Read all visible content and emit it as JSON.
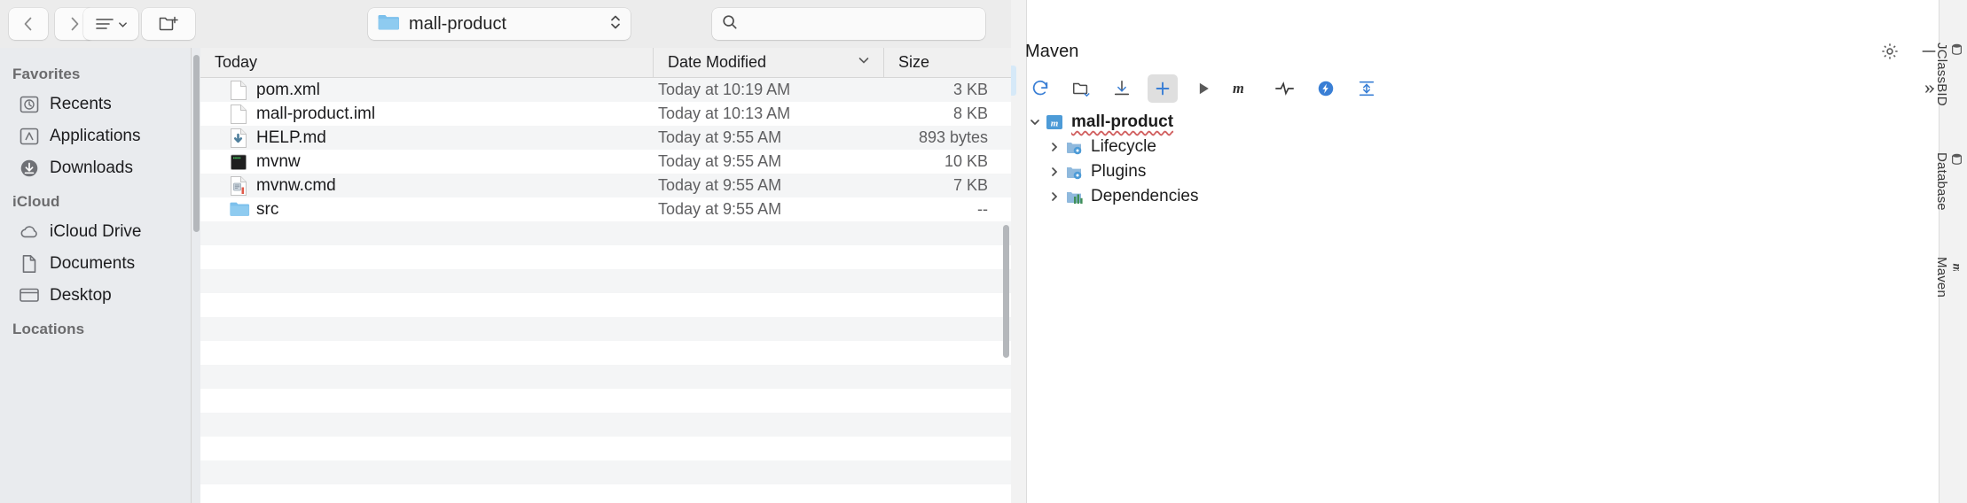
{
  "finder": {
    "toolbar": {
      "back_label": "Back",
      "forward_label": "Forward",
      "view_label": "View options",
      "new_folder_label": "New Folder",
      "path_label": "mall-product",
      "path_icon": "folder-icon",
      "search_placeholder": "",
      "search_value": "",
      "search_icon": "search-icon"
    },
    "sidebar": {
      "sections": [
        {
          "title": "Favorites",
          "items": [
            {
              "label": "Recents",
              "icon": "clock-icon"
            },
            {
              "label": "Applications",
              "icon": "applications-icon"
            },
            {
              "label": "Downloads",
              "icon": "downloads-icon"
            }
          ]
        },
        {
          "title": "iCloud",
          "items": [
            {
              "label": "iCloud Drive",
              "icon": "cloud-icon"
            },
            {
              "label": "Documents",
              "icon": "documents-icon"
            },
            {
              "label": "Desktop",
              "icon": "desktop-icon"
            }
          ]
        },
        {
          "title": "Locations",
          "items": []
        }
      ]
    },
    "columns": {
      "name": "Today",
      "date_modified": "Date Modified",
      "size": "Size",
      "sort_icon": "chevron-down-icon"
    },
    "files": [
      {
        "name": "pom.xml",
        "icon": "document-icon",
        "date": "Today at 10:19 AM",
        "size": "3 KB"
      },
      {
        "name": "mall-product.iml",
        "icon": "document-icon",
        "date": "Today at 10:13 AM",
        "size": "8 KB"
      },
      {
        "name": "HELP.md",
        "icon": "markdown-icon",
        "date": "Today at 9:55 AM",
        "size": "893 bytes"
      },
      {
        "name": "mvnw",
        "icon": "terminal-icon",
        "date": "Today at 9:55 AM",
        "size": "10 KB"
      },
      {
        "name": "mvnw.cmd",
        "icon": "script-icon",
        "date": "Today at 9:55 AM",
        "size": "7 KB"
      },
      {
        "name": "src",
        "icon": "folder-icon",
        "date": "Today at 9:55 AM",
        "size": "--"
      }
    ]
  },
  "ide": {
    "maven": {
      "title": "Maven",
      "header_actions": [
        {
          "name": "gear-icon",
          "label": "Settings"
        },
        {
          "name": "minimize-icon",
          "label": "Hide"
        }
      ],
      "toolbar": [
        {
          "name": "reload-icon",
          "label": "Reload All Maven Projects",
          "active": false
        },
        {
          "name": "add-folder-icon",
          "label": "Add Maven Project",
          "active": false
        },
        {
          "name": "download-icon",
          "label": "Download Sources",
          "active": false
        },
        {
          "name": "plus-icon",
          "label": "Add",
          "active": true
        },
        {
          "name": "run-icon",
          "label": "Run",
          "active": false
        },
        {
          "name": "execute-goal-icon",
          "label": "Execute Maven Goal",
          "active": false
        },
        {
          "name": "skip-tests-icon",
          "label": "Toggle Skip Tests",
          "active": false
        },
        {
          "name": "offline-icon",
          "label": "Toggle Offline Mode",
          "active": false
        },
        {
          "name": "expand-icon",
          "label": "Expand All",
          "active": false
        },
        {
          "name": "more-icon",
          "label": "More",
          "active": false
        }
      ],
      "tree": [
        {
          "label": "mall-product",
          "icon": "maven-project-icon",
          "depth": 0,
          "expanded": true
        },
        {
          "label": "Lifecycle",
          "icon": "lifecycle-icon",
          "depth": 1,
          "expanded": false
        },
        {
          "label": "Plugins",
          "icon": "plugins-icon",
          "depth": 1,
          "expanded": false
        },
        {
          "label": "Dependencies",
          "icon": "dependencies-icon",
          "depth": 1,
          "expanded": false
        }
      ]
    },
    "right_tool_tabs": [
      {
        "label": "JClassBID",
        "icon": "database-icon"
      },
      {
        "label": "Database",
        "icon": "database-icon"
      },
      {
        "label": "Maven",
        "icon": "maven-icon"
      }
    ]
  },
  "colors": {
    "folder_blue": "#6cb8e8",
    "toolbar_bg": "#ececec",
    "sidebar_bg": "#e9ebee",
    "row_alt": "#f4f5f6",
    "accent": "#3574f0"
  }
}
